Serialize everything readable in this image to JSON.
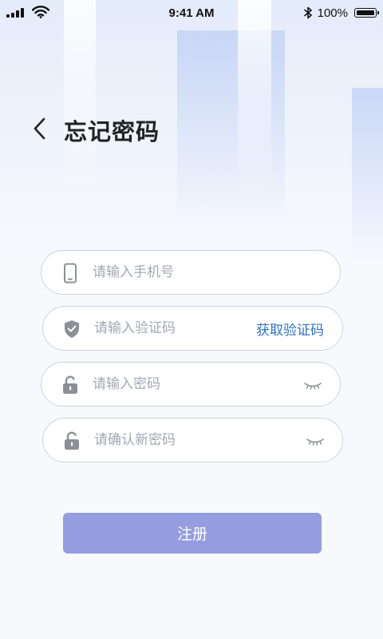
{
  "status_bar": {
    "time": "9:41 AM",
    "battery_text": "100%",
    "battery_level": 1.0
  },
  "header": {
    "back_icon": "chevron-left-icon",
    "title": "忘记密码"
  },
  "form": {
    "phone": {
      "icon": "phone-icon",
      "placeholder": "请输入手机号",
      "value": ""
    },
    "code": {
      "icon": "shield-check-icon",
      "placeholder": "请输入验证码",
      "value": "",
      "action_label": "获取验证码"
    },
    "password": {
      "icon": "lock-icon",
      "placeholder": "请输入密码",
      "value": "",
      "toggle_icon": "eye-closed-icon"
    },
    "confirm_password": {
      "icon": "lock-icon",
      "placeholder": "请确认新密码",
      "value": "",
      "toggle_icon": "eye-closed-icon"
    },
    "submit_label": "注册"
  },
  "colors": {
    "accent_link": "#2f72c4",
    "submit_button": "#959cdf",
    "input_border": "#cfd3db",
    "placeholder_text": "#a3a8b2",
    "icon_gray": "#8c8f96"
  }
}
